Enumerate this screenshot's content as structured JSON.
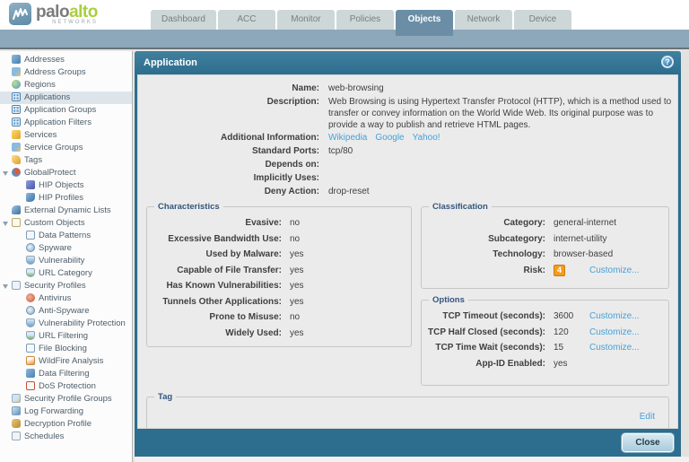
{
  "brand": {
    "word1": "palo",
    "word2": "alto",
    "subtitle": "NETWORKS"
  },
  "nav": {
    "tabs": [
      {
        "label": "Dashboard",
        "active": false
      },
      {
        "label": "ACC",
        "active": false
      },
      {
        "label": "Monitor",
        "active": false
      },
      {
        "label": "Policies",
        "active": false
      },
      {
        "label": "Objects",
        "active": true
      },
      {
        "label": "Network",
        "active": false
      },
      {
        "label": "Device",
        "active": false
      }
    ]
  },
  "sidebar": {
    "items": [
      {
        "label": "Addresses",
        "icon": "addresses-icon",
        "level": 0,
        "selected": false
      },
      {
        "label": "Address Groups",
        "icon": "address-groups-icon",
        "level": 0,
        "selected": false
      },
      {
        "label": "Regions",
        "icon": "regions-globe-icon",
        "level": 0,
        "selected": false
      },
      {
        "label": "Applications",
        "icon": "applications-grid-icon",
        "level": 0,
        "selected": true
      },
      {
        "label": "Application Groups",
        "icon": "application-groups-icon",
        "level": 0,
        "selected": false
      },
      {
        "label": "Application Filters",
        "icon": "application-filters-icon",
        "level": 0,
        "selected": false
      },
      {
        "label": "Services",
        "icon": "services-icon",
        "level": 0,
        "selected": false
      },
      {
        "label": "Service Groups",
        "icon": "service-groups-icon",
        "level": 0,
        "selected": false
      },
      {
        "label": "Tags",
        "icon": "tags-icon",
        "level": 0,
        "selected": false
      },
      {
        "label": "GlobalProtect",
        "icon": "globalprotect-icon",
        "level": 0,
        "selected": false,
        "expanded": true
      },
      {
        "label": "HIP Objects",
        "icon": "hip-objects-icon",
        "level": 1,
        "selected": false
      },
      {
        "label": "HIP Profiles",
        "icon": "hip-profiles-icon",
        "level": 1,
        "selected": false
      },
      {
        "label": "External Dynamic Lists",
        "icon": "external-dynamic-lists-icon",
        "level": 0,
        "selected": false
      },
      {
        "label": "Custom Objects",
        "icon": "custom-objects-icon",
        "level": 0,
        "selected": false,
        "expanded": true
      },
      {
        "label": "Data Patterns",
        "icon": "data-patterns-icon",
        "level": 1,
        "selected": false
      },
      {
        "label": "Spyware",
        "icon": "spyware-icon",
        "level": 1,
        "selected": false
      },
      {
        "label": "Vulnerability",
        "icon": "vulnerability-icon",
        "level": 1,
        "selected": false
      },
      {
        "label": "URL Category",
        "icon": "url-category-icon",
        "level": 1,
        "selected": false
      },
      {
        "label": "Security Profiles",
        "icon": "security-profiles-icon",
        "level": 0,
        "selected": false,
        "expanded": true
      },
      {
        "label": "Antivirus",
        "icon": "antivirus-icon",
        "level": 1,
        "selected": false
      },
      {
        "label": "Anti-Spyware",
        "icon": "anti-spyware-icon",
        "level": 1,
        "selected": false
      },
      {
        "label": "Vulnerability Protection",
        "icon": "vulnerability-protection-icon",
        "level": 1,
        "selected": false
      },
      {
        "label": "URL Filtering",
        "icon": "url-filtering-icon",
        "level": 1,
        "selected": false
      },
      {
        "label": "File Blocking",
        "icon": "file-blocking-icon",
        "level": 1,
        "selected": false
      },
      {
        "label": "WildFire Analysis",
        "icon": "wildfire-analysis-icon",
        "level": 1,
        "selected": false
      },
      {
        "label": "Data Filtering",
        "icon": "data-filtering-icon",
        "level": 1,
        "selected": false
      },
      {
        "label": "DoS Protection",
        "icon": "dos-protection-icon",
        "level": 1,
        "selected": false
      },
      {
        "label": "Security Profile Groups",
        "icon": "security-profile-groups-icon",
        "level": 0,
        "selected": false
      },
      {
        "label": "Log Forwarding",
        "icon": "log-forwarding-icon",
        "level": 0,
        "selected": false
      },
      {
        "label": "Decryption Profile",
        "icon": "decryption-profile-icon",
        "level": 0,
        "selected": false
      },
      {
        "label": "Schedules",
        "icon": "schedules-icon",
        "level": 0,
        "selected": false
      }
    ]
  },
  "dialog": {
    "title": "Application",
    "help_icon": "help-icon",
    "fields": {
      "name": {
        "label": "Name:",
        "value": "web-browsing"
      },
      "description": {
        "label": "Description:",
        "value": "Web Browsing is using Hypertext Transfer Protocol (HTTP), which is a method used to transfer or convey information on the World Wide Web. Its original purpose was to provide a way to publish and retrieve HTML pages."
      },
      "additional_information": {
        "label": "Additional Information:",
        "links": [
          "Wikipedia",
          "Google",
          "Yahoo!"
        ]
      },
      "standard_ports": {
        "label": "Standard Ports:",
        "value": "tcp/80"
      },
      "depends_on": {
        "label": "Depends on:",
        "value": ""
      },
      "implicitly_uses": {
        "label": "Implicitly Uses:",
        "value": ""
      },
      "deny_action": {
        "label": "Deny Action:",
        "value": "drop-reset"
      }
    },
    "characteristics": {
      "title": "Characteristics",
      "rows": [
        {
          "label": "Evasive:",
          "value": "no"
        },
        {
          "label": "Excessive Bandwidth Use:",
          "value": "no"
        },
        {
          "label": "Used by Malware:",
          "value": "yes"
        },
        {
          "label": "Capable of File Transfer:",
          "value": "yes"
        },
        {
          "label": "Has Known Vulnerabilities:",
          "value": "yes"
        },
        {
          "label": "Tunnels Other Applications:",
          "value": "yes"
        },
        {
          "label": "Prone to Misuse:",
          "value": "no"
        },
        {
          "label": "Widely Used:",
          "value": "yes"
        }
      ]
    },
    "classification": {
      "title": "Classification",
      "rows": [
        {
          "label": "Category:",
          "value": "general-internet"
        },
        {
          "label": "Subcategory:",
          "value": "internet-utility"
        },
        {
          "label": "Technology:",
          "value": "browser-based"
        }
      ],
      "risk": {
        "label": "Risk:",
        "value": "4",
        "badge_color": "#f59c1e"
      }
    },
    "options": {
      "title": "Options",
      "rows": [
        {
          "label": "TCP Timeout (seconds):",
          "value": "3600",
          "customize": true
        },
        {
          "label": "TCP Half Closed (seconds):",
          "value": "120",
          "customize": true
        },
        {
          "label": "TCP Time Wait (seconds):",
          "value": "15",
          "customize": true
        },
        {
          "label": "App-ID Enabled:",
          "value": "yes",
          "customize": false
        }
      ]
    },
    "customize_label": "Customize...",
    "tag": {
      "title": "Tag",
      "edit_label": "Edit"
    },
    "close_label": "Close"
  },
  "colors": {
    "titlebar_teal": "#2d6d8d",
    "bluebar": "#8da7bb",
    "active_tab": "#6b8ea6",
    "link_blue": "#44a2d8",
    "risk_orange": "#f59c1e",
    "logo_green": "#a9cf3d"
  }
}
